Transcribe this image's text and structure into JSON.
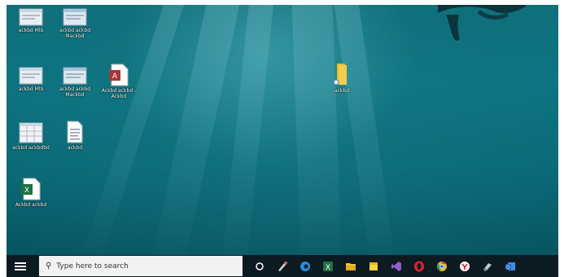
{
  "desktop": {
    "icons": [
      {
        "label": "ackbd Mlb",
        "icon": "window-shortcut-icon"
      },
      {
        "label": "ackbd ackbd Mackbd",
        "icon": "window-shortcut-icon"
      },
      {
        "label": "ackbd Mlb",
        "icon": "window-shortcut-icon"
      },
      {
        "label": "ackbd ackbd Mackbd",
        "icon": "window-shortcut-icon"
      },
      {
        "label": "Ackbd ackbd - Ackbd",
        "icon": "access-file-icon"
      },
      {
        "label": "ackbd ackbdbd",
        "icon": "spreadsheet-window-icon"
      },
      {
        "label": "ackbd",
        "icon": "text-document-icon"
      },
      {
        "label": "Ackbd ackbd",
        "icon": "excel-file-icon"
      },
      {
        "label": "ackbd",
        "icon": "folder-icon"
      }
    ]
  },
  "taskbar": {
    "search_placeholder": "Type here to search",
    "pinned_icons": [
      "task-view-icon",
      "paint-icon",
      "edge-icon",
      "excel-icon",
      "file-explorer-icon",
      "sticky-notes-icon",
      "visual-studio-icon",
      "opera-icon",
      "chrome-icon",
      "yandex-icon",
      "snipping-tool-icon",
      "outlook-icon"
    ]
  },
  "colors": {
    "taskbar_bg": "#0c1a22",
    "search_bg": "#f2f2f2",
    "wallpaper": "#0e7481"
  }
}
